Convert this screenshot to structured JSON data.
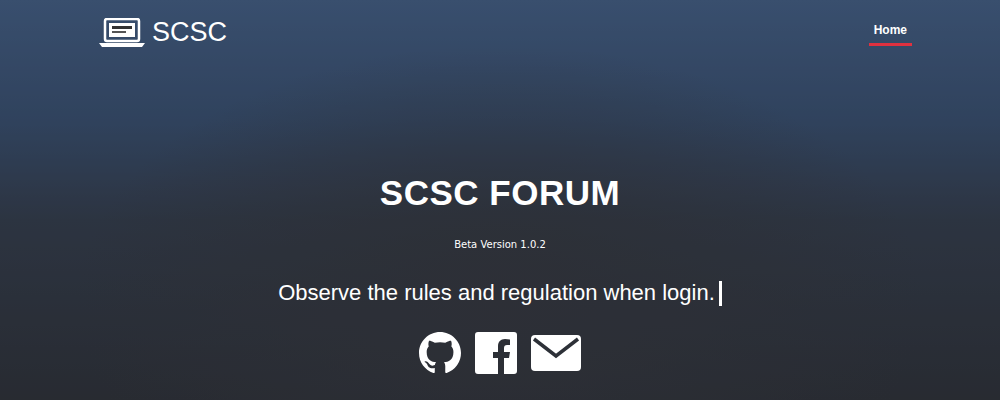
{
  "brand": "SCSC",
  "nav": [
    {
      "label": "Home",
      "selected": true
    }
  ],
  "hero": {
    "title": "SCSC FORUM",
    "version": "Beta Version 1.0.2",
    "tagline": "Observe the rules and regulation when login.",
    "cursor_visible": true
  }
}
